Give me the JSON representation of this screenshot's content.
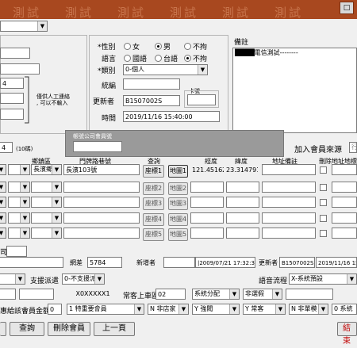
{
  "window": {
    "watermark": [
      "測試",
      "測試",
      "測試",
      "測試",
      "測試",
      "測試"
    ],
    "maximize_glyph": "□"
  },
  "top_left": {
    "dropdown_value": "",
    "field_value": "4",
    "fields": [
      "",
      "",
      "",
      ""
    ]
  },
  "member_info": {
    "note_contact": "僅供人工連絡\n, 可以不輸入",
    "gender": {
      "label": "*性別",
      "options": [
        "女",
        "男",
        "不拘"
      ],
      "selected": "男"
    },
    "language": {
      "label": "語言",
      "options": [
        "國語",
        "台語",
        "不拘"
      ],
      "selected": "不拘"
    },
    "category": {
      "label": "*類別",
      "value": "0-個人"
    },
    "tax_id": {
      "label": "統編",
      "value": ""
    },
    "card_no": {
      "label": "卡號",
      "value": ""
    },
    "updater": {
      "label": "更新者",
      "value": "B1507002S"
    },
    "time": {
      "label": "時間",
      "value": "2019/11/16 15:40:00"
    }
  },
  "remarks": {
    "label": "備註",
    "content_redacted": "████",
    "content": "電信測試--------"
  },
  "member_join": {
    "billing_label": "帳號公司會員號",
    "billing_value": "",
    "count_value": "4",
    "count_suffix": "(10碼)",
    "source_label": "加入會員來源",
    "source_value": "行"
  },
  "address_table": {
    "headers": [
      "鄉鎮區",
      "門牌路巷號",
      "查詢",
      "經度",
      "緯度",
      "地址備註",
      "刪除地址地標"
    ],
    "rows": [
      {
        "township": "長濱鄉",
        "street": "長濱103號",
        "coord_btn": "座標1",
        "map_btn": "地圖1",
        "lng": "121.451628",
        "lat": "23.314791",
        "note": ""
      },
      {
        "township": "",
        "street": "",
        "coord_btn": "座標2",
        "map_btn": "地圖2",
        "lng": "",
        "lat": "",
        "note": ""
      },
      {
        "township": "",
        "street": "",
        "coord_btn": "座標3",
        "map_btn": "地圖3",
        "lng": "",
        "lat": "",
        "note": ""
      },
      {
        "township": "",
        "street": "",
        "coord_btn": "座標4",
        "map_btn": "地圖4",
        "lng": "",
        "lat": "",
        "note": ""
      },
      {
        "township": "",
        "street": "",
        "coord_btn": "座標5",
        "map_btn": "地圖5",
        "lng": "",
        "lat": "",
        "note": ""
      }
    ]
  },
  "meta_row": {
    "fragment_label": "司",
    "web_label": "網差",
    "web_value": "5784",
    "creator_label": "新增者",
    "creator_value": "|2009/07/21 17:32:34",
    "updater_label": "更新者",
    "updater_value": "B1507002S",
    "updater_time": "2019/11/16 15:40"
  },
  "dispatch_row": {
    "support_label": "支援派遣",
    "support_value": "0-不支援派",
    "voice_label": "語音流程",
    "voice_value": "X-系統預設"
  },
  "region_row": {
    "code_value": "X0XXXXX1",
    "region_label": "常客上車區域",
    "region_value": "02",
    "dist_value": "系統分配",
    "not_spec_value": "非選假"
  },
  "bonus_row": {
    "label": "惠給該會員金額",
    "amount_value": "0",
    "vip_value": "1 特重要會員",
    "n_shop": "N 非店家",
    "y_hint": "Y 強閥",
    "y_regular": "Y 常客",
    "n_single": "N 非單模",
    "sys_value": "0 系統"
  },
  "bottom_buttons": {
    "query": "查詢",
    "delete_member": "刪除會員",
    "prev_page": "上一頁",
    "close": "結束"
  }
}
